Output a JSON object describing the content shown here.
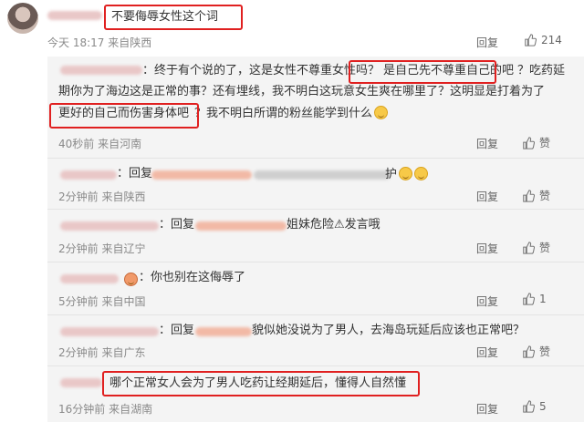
{
  "main_comment": {
    "text": "不要侮辱女性这个词",
    "meta": "今天 18:17 来自陕西",
    "reply_label": "回复",
    "likes": "214"
  },
  "replies": [
    {
      "lines": [
        "：终于有个说的了，这是女性不尊重女性吗？",
        "是自己先不尊重自己的吧",
        "？吃药延",
        "期你为了海边这是正常的事？还有埋线，我不明白这玩意女生爽在哪里了？这明显是打着为了",
        "更好的自己而伤害身体吧",
        "？我不明白所谓的粉丝能学到什么"
      ],
      "meta": "40秒前 来自河南",
      "reply_label": "回复",
      "like_label": "赞"
    },
    {
      "prefix": "：回复",
      "text_end": "护",
      "meta": "2分钟前 来自陕西",
      "reply_label": "回复",
      "like_label": "赞"
    },
    {
      "prefix": "：回复",
      "text": "姐妹危险⚠发言哦",
      "meta": "2分钟前 来自辽宁",
      "reply_label": "回复",
      "like_label": "赞"
    },
    {
      "text": "：你也别在这侮辱了",
      "meta": "5分钟前 来自中国",
      "reply_label": "回复",
      "likes": "1"
    },
    {
      "prefix": "：回复",
      "text": "貌似她没说为了男人，去海岛玩延后应该也正常吧？",
      "meta": "2分钟前 来自广东",
      "reply_label": "回复",
      "like_label": "赞"
    },
    {
      "text": "哪个正常女人会为了男人吃药让经期延后，懂得人自然懂",
      "meta": "16分钟前 来自湖南",
      "reply_label": "回复",
      "likes": "5"
    }
  ],
  "colors": {
    "highlight_box": "#e02020",
    "meta": "#8a8a8a",
    "sub_bg": "#f4f4f4",
    "mention": "#eb7350"
  }
}
